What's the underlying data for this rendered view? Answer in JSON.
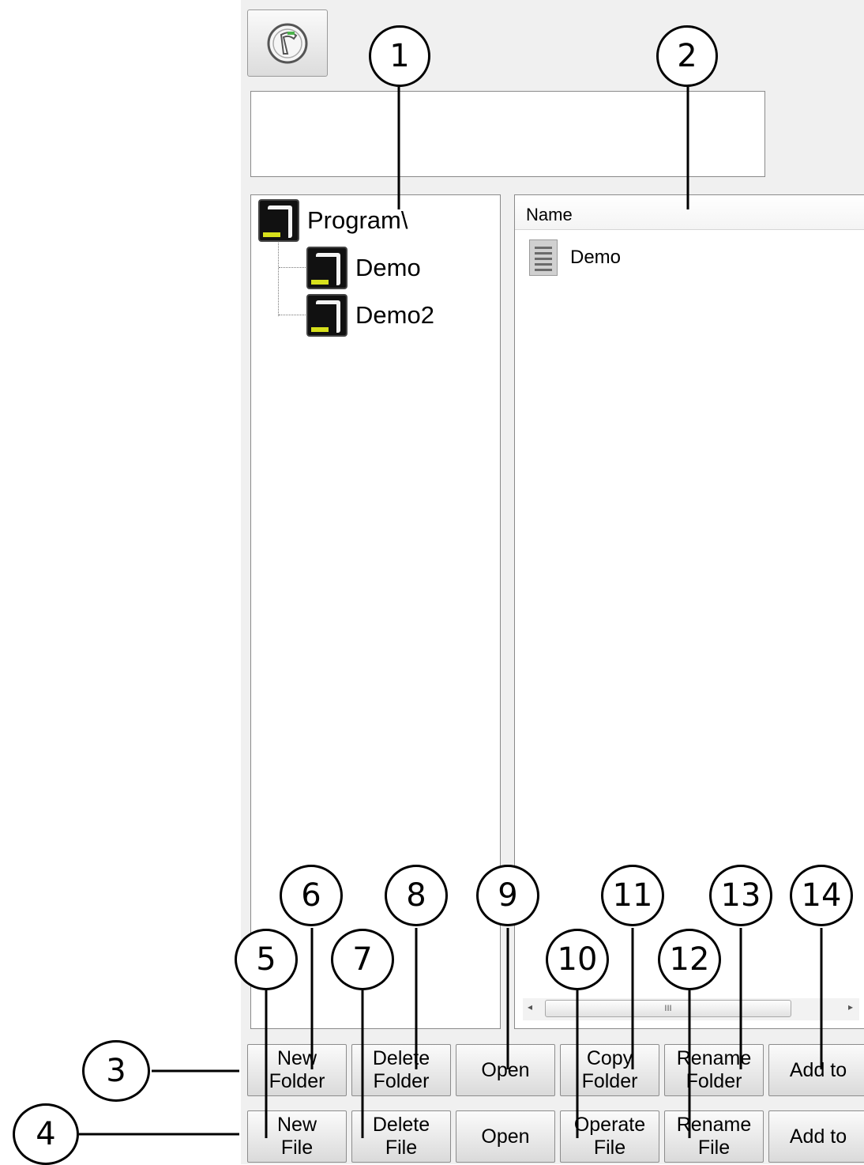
{
  "callouts": {
    "c1": "1",
    "c2": "2",
    "c3": "3",
    "c4": "4",
    "c5": "5",
    "c6": "6",
    "c7": "7",
    "c8": "8",
    "c9": "9",
    "c10": "10",
    "c11": "11",
    "c12": "12",
    "c13": "13",
    "c14": "14"
  },
  "path_box": {
    "value": ""
  },
  "tree": {
    "root": "Program\\",
    "children": [
      "Demo",
      "Demo2"
    ]
  },
  "list": {
    "header": "Name",
    "items": [
      "Demo"
    ]
  },
  "scrollbar": {
    "thumb_grip": "III"
  },
  "folder_buttons": {
    "new_folder": [
      "New",
      "Folder"
    ],
    "delete_folder": [
      "Delete",
      "Folder"
    ],
    "open": "Open",
    "copy_folder": [
      "Copy",
      "Folder"
    ],
    "rename_folder": [
      "Rename",
      "Folder"
    ],
    "add_to": "Add to"
  },
  "file_buttons": {
    "new_file": [
      "New",
      "File"
    ],
    "delete_file": [
      "Delete",
      "File"
    ],
    "open": "Open",
    "operate_file": [
      "Operate",
      "File"
    ],
    "rename_file": [
      "Rename",
      "File"
    ],
    "add_to": "Add to"
  },
  "icons": {
    "app_button": "robot-arm-icon",
    "tree_node": "robot-folder-icon",
    "list_item": "document-icon"
  }
}
